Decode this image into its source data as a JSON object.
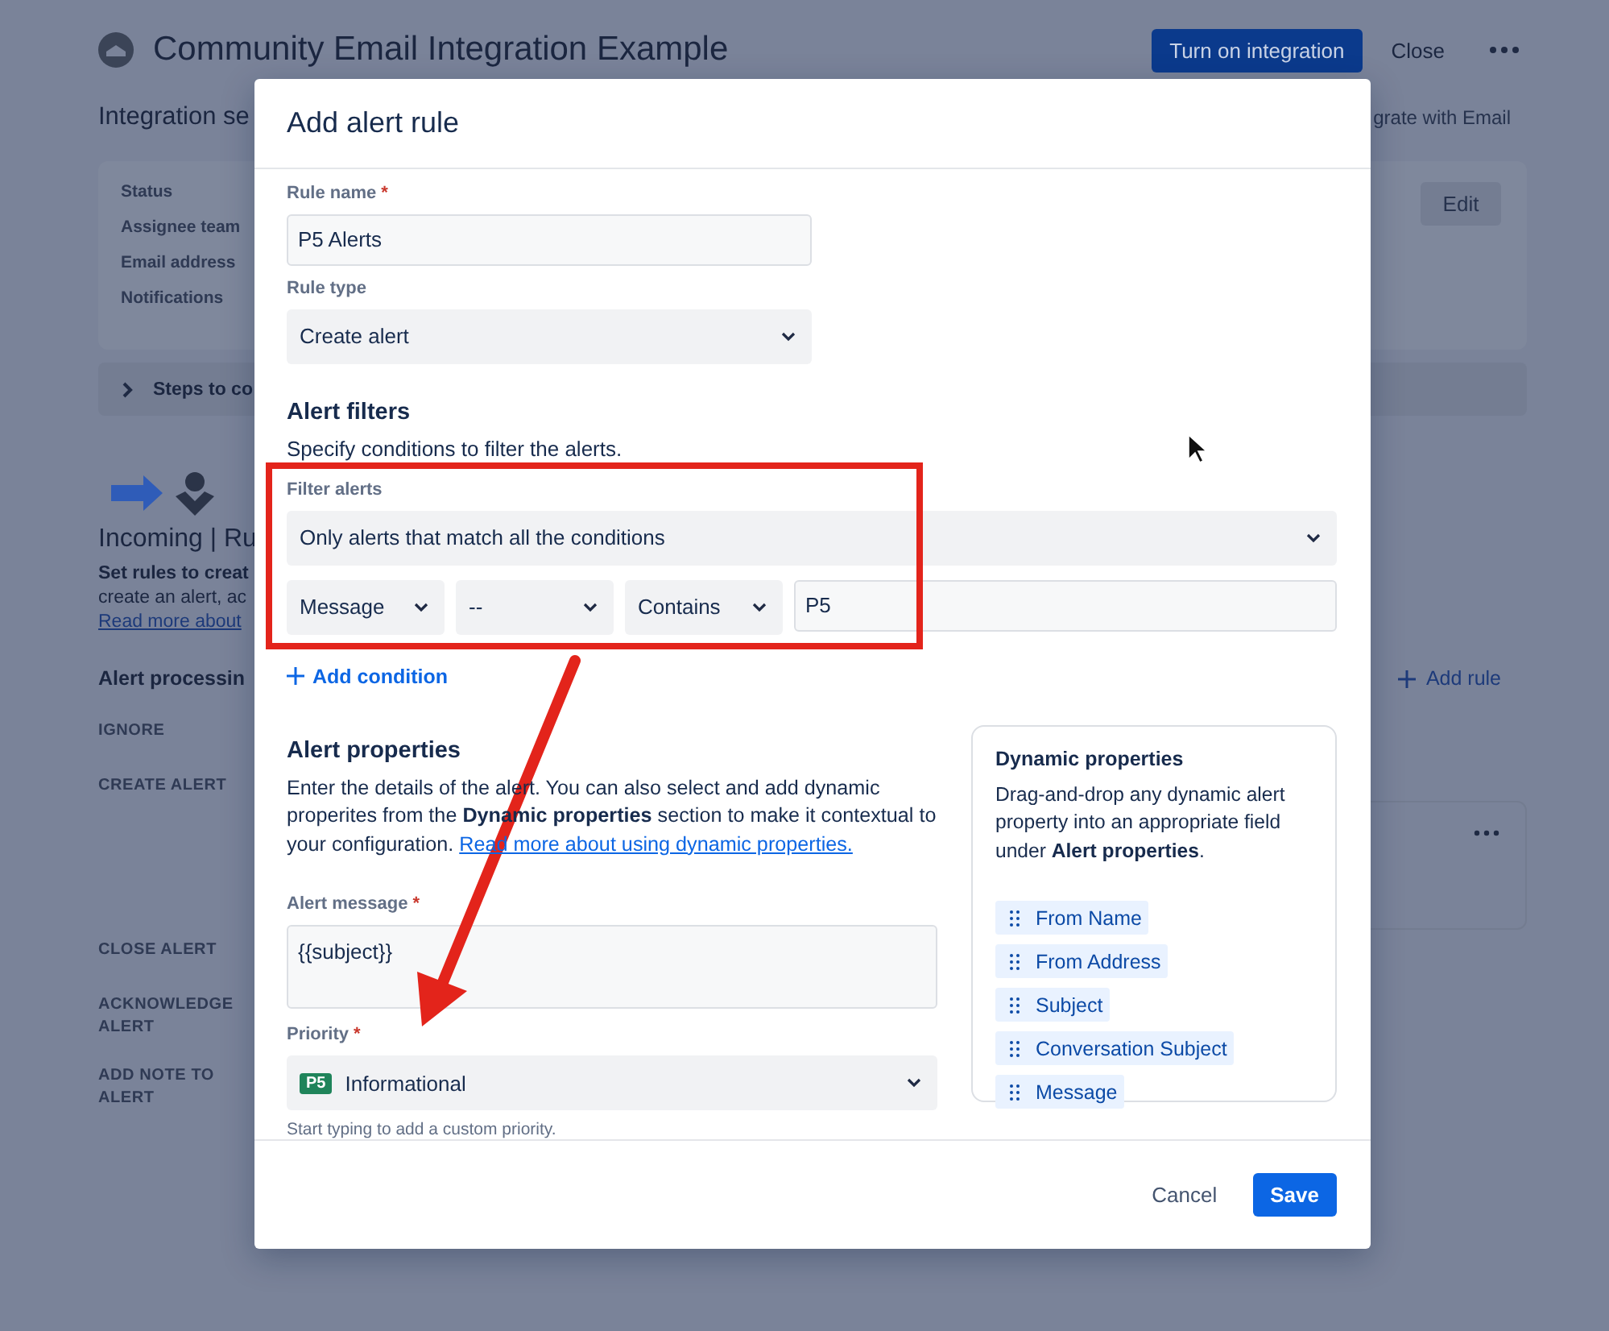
{
  "page": {
    "title": "Community Email Integration Example",
    "primary_action": "Turn on integration",
    "close": "Close",
    "section_title": "Integration se",
    "side_link": "grate with Email",
    "settings": {
      "labels": [
        "Status",
        "Assignee team",
        "Email address",
        "Notifications"
      ],
      "edit": "Edit"
    },
    "steps": {
      "label": "Steps to co",
      "expanded": false
    },
    "incoming": {
      "title": "Incoming | Ru",
      "lead": "Set rules to creat",
      "text": "create an alert, ac",
      "link": "Read more about"
    },
    "processing": {
      "title": "Alert processin",
      "add_rule": "Add rule",
      "actions": [
        "IGNORE",
        "CREATE ALERT",
        "CLOSE ALERT",
        "ACKNOWLEDGE ALERT",
        "ADD NOTE TO ALERT"
      ]
    }
  },
  "dialog": {
    "title": "Add alert rule",
    "rule_name": {
      "label": "Rule name",
      "required_mark": "*",
      "value": "P5 Alerts"
    },
    "rule_type": {
      "label": "Rule type",
      "value": "Create alert"
    },
    "filters": {
      "title": "Alert filters",
      "description": "Specify conditions to filter the alerts.",
      "label": "Filter alerts",
      "match": "Only alerts that match all the conditions",
      "conditions": [
        {
          "field": "Message",
          "qualifier": "--",
          "operator": "Contains",
          "value": "P5"
        }
      ],
      "add": "Add condition"
    },
    "properties": {
      "title": "Alert properties",
      "description": "Enter the details of the alert. You can also select and add dynamic properites from the **Dynamic properties** section to make it contextual to your configuration.",
      "link": "Read more about using dynamic properties.",
      "message": {
        "label": "Alert message",
        "required_mark": "*",
        "value": "{{subject}}"
      },
      "priority": {
        "label": "Priority",
        "required_mark": "*",
        "badge": "P5",
        "value": "Informational",
        "help": "Start typing to add a custom priority."
      }
    },
    "dynamic": {
      "title": "Dynamic properties",
      "description": "Drag-and-drop any dynamic alert property into an appropriate field under **Alert properties**.",
      "tags": [
        "From Name",
        "From Address",
        "Subject",
        "Conversation Subject",
        "Message"
      ]
    },
    "buttons": {
      "cancel": "Cancel",
      "save": "Save"
    }
  }
}
